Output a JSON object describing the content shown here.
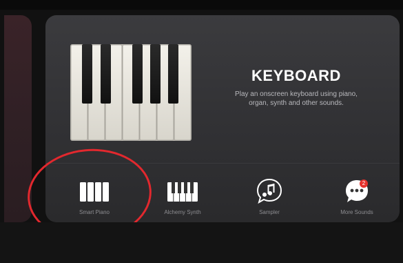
{
  "category": {
    "title": "KEYBOARD",
    "description_line1": "Play an onscreen keyboard using piano,",
    "description_line2": "organ, synth and other sounds."
  },
  "instruments": [
    {
      "label": "Smart Piano",
      "icon": "smart-piano-icon"
    },
    {
      "label": "Alchemy Synth",
      "icon": "alchemy-synth-icon"
    },
    {
      "label": "Sampler",
      "icon": "sampler-icon"
    },
    {
      "label": "More Sounds",
      "icon": "more-sounds-icon",
      "badge": "2"
    }
  ],
  "colors": {
    "annotation_circle": "#e2282e",
    "badge": "#e5322d",
    "card_background": "#333336"
  }
}
